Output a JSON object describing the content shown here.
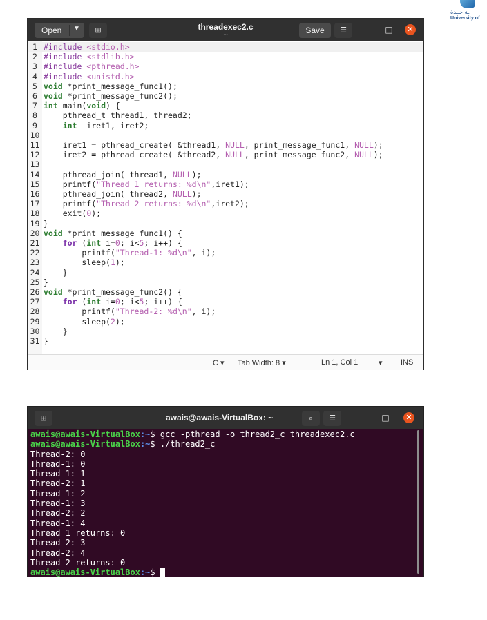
{
  "logo": {
    "arabic_text": "ـة جــدة",
    "english_text": "University of"
  },
  "editor": {
    "title": "threadexec2.c",
    "subtitle": "~",
    "open_label": "Open",
    "save_label": "Save",
    "code_lines": [
      "#include <stdio.h>",
      "#include <stdlib.h>",
      "#include <pthread.h>",
      "#include <unistd.h>",
      "void *print_message_func1();",
      "void *print_message_func2();",
      "int main(void) {",
      "    pthread_t thread1, thread2;",
      "    int  iret1, iret2;",
      "",
      "    iret1 = pthread_create( &thread1, NULL, print_message_func1, NULL);",
      "    iret2 = pthread_create( &thread2, NULL, print_message_func2, NULL);",
      "",
      "    pthread_join( thread1, NULL);",
      "    printf(\"Thread 1 returns: %d\\n\",iret1);",
      "    pthread_join( thread2, NULL);",
      "    printf(\"Thread 2 returns: %d\\n\",iret2);",
      "    exit(0);",
      "}",
      "void *print_message_func1() {",
      "    for (int i=0; i<5; i++) {",
      "        printf(\"Thread-1: %d\\n\", i);",
      "        sleep(1);",
      "    }",
      "}",
      "void *print_message_func2() {",
      "    for (int i=0; i<5; i++) {",
      "        printf(\"Thread-2: %d\\n\", i);",
      "        sleep(2);",
      "    }",
      "}"
    ],
    "status": {
      "language": "C ▾",
      "tab_width": "Tab Width: 8 ▾",
      "position": "Ln 1, Col 1",
      "mode_chevron": "▾",
      "insert_mode": "INS"
    }
  },
  "terminal": {
    "title": "awais@awais-VirtualBox: ~",
    "prompt_user": "awais@awais-VirtualBox",
    "prompt_path": ":~",
    "prompt_symbol": "$ ",
    "commands": [
      "gcc -pthread -o thread2_c threadexec2.c",
      "./thread2_c"
    ],
    "output_lines": [
      "Thread-2: 0",
      "Thread-1: 0",
      "Thread-1: 1",
      "Thread-2: 1",
      "Thread-1: 2",
      "Thread-1: 3",
      "Thread-2: 2",
      "Thread-1: 4",
      "Thread 1 returns: 0",
      "Thread-2: 3",
      "Thread-2: 4",
      "Thread 2 returns: 0"
    ]
  },
  "colors": {
    "terminal_bg": "#300a24",
    "prompt_user": "#4ad44a",
    "prompt_path": "#5c8ee8",
    "close_button": "#e9541f",
    "keyword": "#7a2fa8",
    "type": "#2e7d32",
    "string": "#b45faf"
  }
}
